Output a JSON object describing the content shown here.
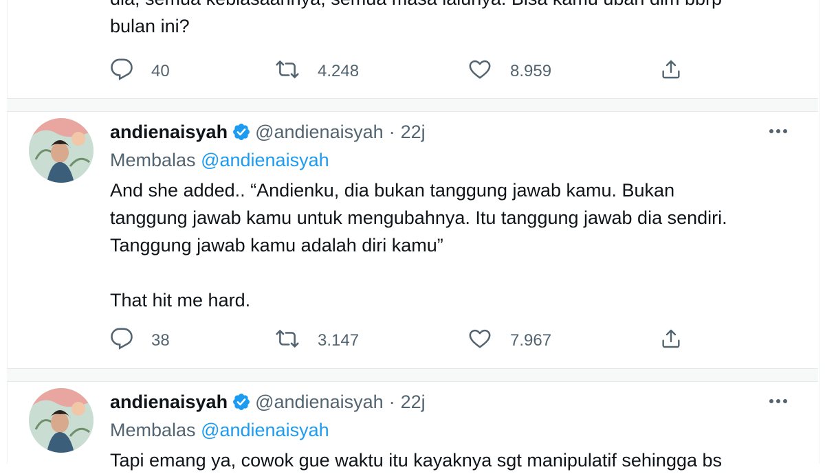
{
  "top_tweet": {
    "text_lines": [
      "dia, semua kebiasaannya, semua masa lalunya. Bisa kamu ubah dlm bbrp",
      "bulan ini?"
    ],
    "replies": "40",
    "retweets": "4.248",
    "likes": "8.959"
  },
  "tweet2": {
    "name": "andienaisyah",
    "handle": "@andienaisyah",
    "separator": "·",
    "time": "22j",
    "reply_prefix": "Membalas",
    "reply_to": "@andienaisyah",
    "text_lines": [
      "And she added.. “Andienku, dia bukan tanggung jawab kamu. Bukan",
      "tanggung jawab kamu untuk mengubahnya. Itu tanggung jawab dia sendiri.",
      "Tanggung jawab kamu adalah diri kamu”",
      "",
      "That hit me hard."
    ],
    "replies": "38",
    "retweets": "3.147",
    "likes": "7.967"
  },
  "tweet3": {
    "name": "andienaisyah",
    "handle": "@andienaisyah",
    "separator": "·",
    "time": "22j",
    "reply_prefix": "Membalas",
    "reply_to": "@andienaisyah",
    "text_lines": [
      "Tapi emang ya, cowok gue waktu itu kayaknya sgt manipulatif sehingga bs"
    ]
  },
  "icons": {
    "reply": "reply-bubble-icon",
    "retweet": "retweet-icon",
    "like": "heart-icon",
    "share": "share-icon",
    "more": "more-dots-icon",
    "verified": "verified-badge-icon"
  },
  "colors": {
    "text": "#0f1419",
    "secondary": "#536471",
    "link": "#1d9bf0",
    "verified": "#1d9bf0",
    "divider": "#f7f9f9"
  }
}
